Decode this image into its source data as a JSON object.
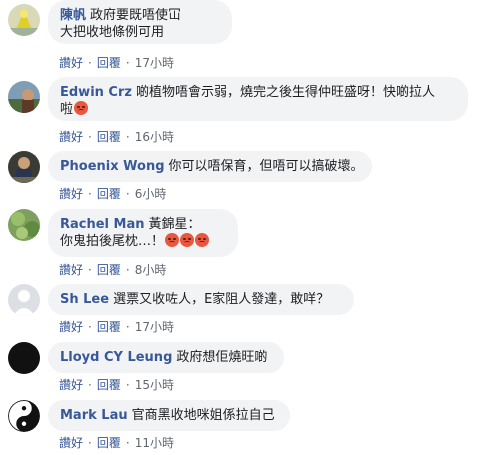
{
  "actions": {
    "like": "讚好",
    "reply": "回覆",
    "separator": "·"
  },
  "comments": [
    {
      "name": "陳帆",
      "text_lines": [
        "政府要既唔使冚",
        "大把收地條例可用"
      ],
      "time": "17小時",
      "emoji_count": 0
    },
    {
      "name": "Edwin Crz",
      "text_lines": [
        "啲植物唔會示弱，燒完之後生得仲旺盛呀！快啲拉人",
        "啦"
      ],
      "time": "16小時",
      "emoji_count": 1
    },
    {
      "name": "Phoenix Wong",
      "text_lines": [
        "你可以唔保育，但唔可以搞破壞。"
      ],
      "time": "6小時",
      "emoji_count": 0
    },
    {
      "name": "Rachel Man",
      "text_lines": [
        "黃錦星：",
        "你鬼拍後尾枕…！"
      ],
      "time": "8小時",
      "emoji_count": 3
    },
    {
      "name": "Sh Lee",
      "text_lines": [
        "選票又收咗人，E家阻人發達，敢咩？"
      ],
      "time": "17小時",
      "emoji_count": 0
    },
    {
      "name": "Lloyd CY Leung",
      "text_lines": [
        "政府想佢燒旺啲"
      ],
      "time": "15小時",
      "emoji_count": 0
    },
    {
      "name": "Mark Lau",
      "text_lines": [
        "官商黑收地咪姐係拉自己"
      ],
      "time": "11小時",
      "emoji_count": 0
    }
  ]
}
